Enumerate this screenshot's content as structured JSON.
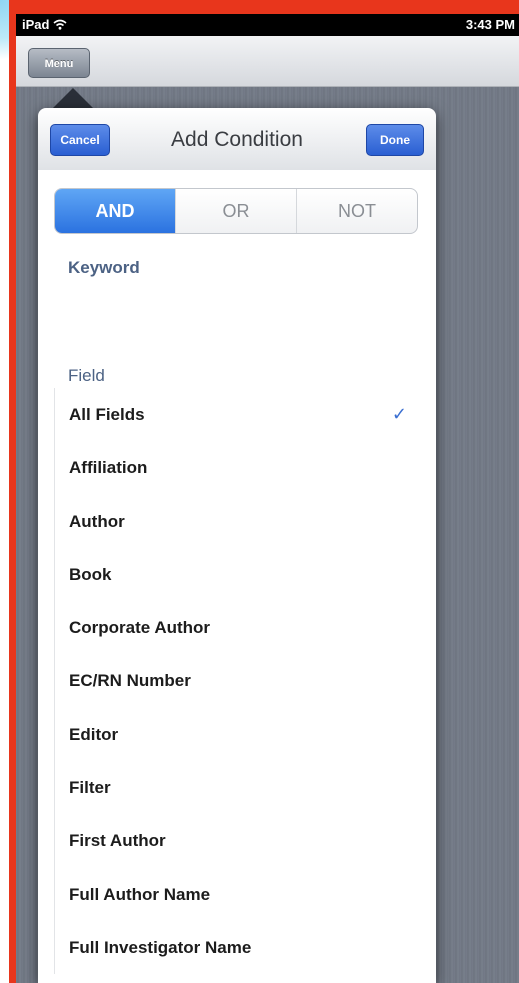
{
  "status_bar": {
    "device": "iPad",
    "time": "3:43 PM"
  },
  "nav": {
    "menu_label": "Menu"
  },
  "popover": {
    "title": "Add Condition",
    "cancel_label": "Cancel",
    "done_label": "Done",
    "segments": [
      "AND",
      "OR",
      "NOT"
    ],
    "selected_segment": "AND",
    "keyword_label": "Keyword",
    "keyword_value": "",
    "field_label": "Field",
    "fields": [
      "All Fields",
      "Affiliation",
      "Author",
      "Book",
      "Corporate Author",
      "EC/RN Number",
      "Editor",
      "Filter",
      "First Author",
      "Full Author Name",
      "Full Investigator Name"
    ],
    "selected_field": "All Fields",
    "check_icon": "✓"
  },
  "colors": {
    "frame_red": "#e8361c",
    "accent_blue": "#2b72e0",
    "section_label": "#4c6284"
  }
}
